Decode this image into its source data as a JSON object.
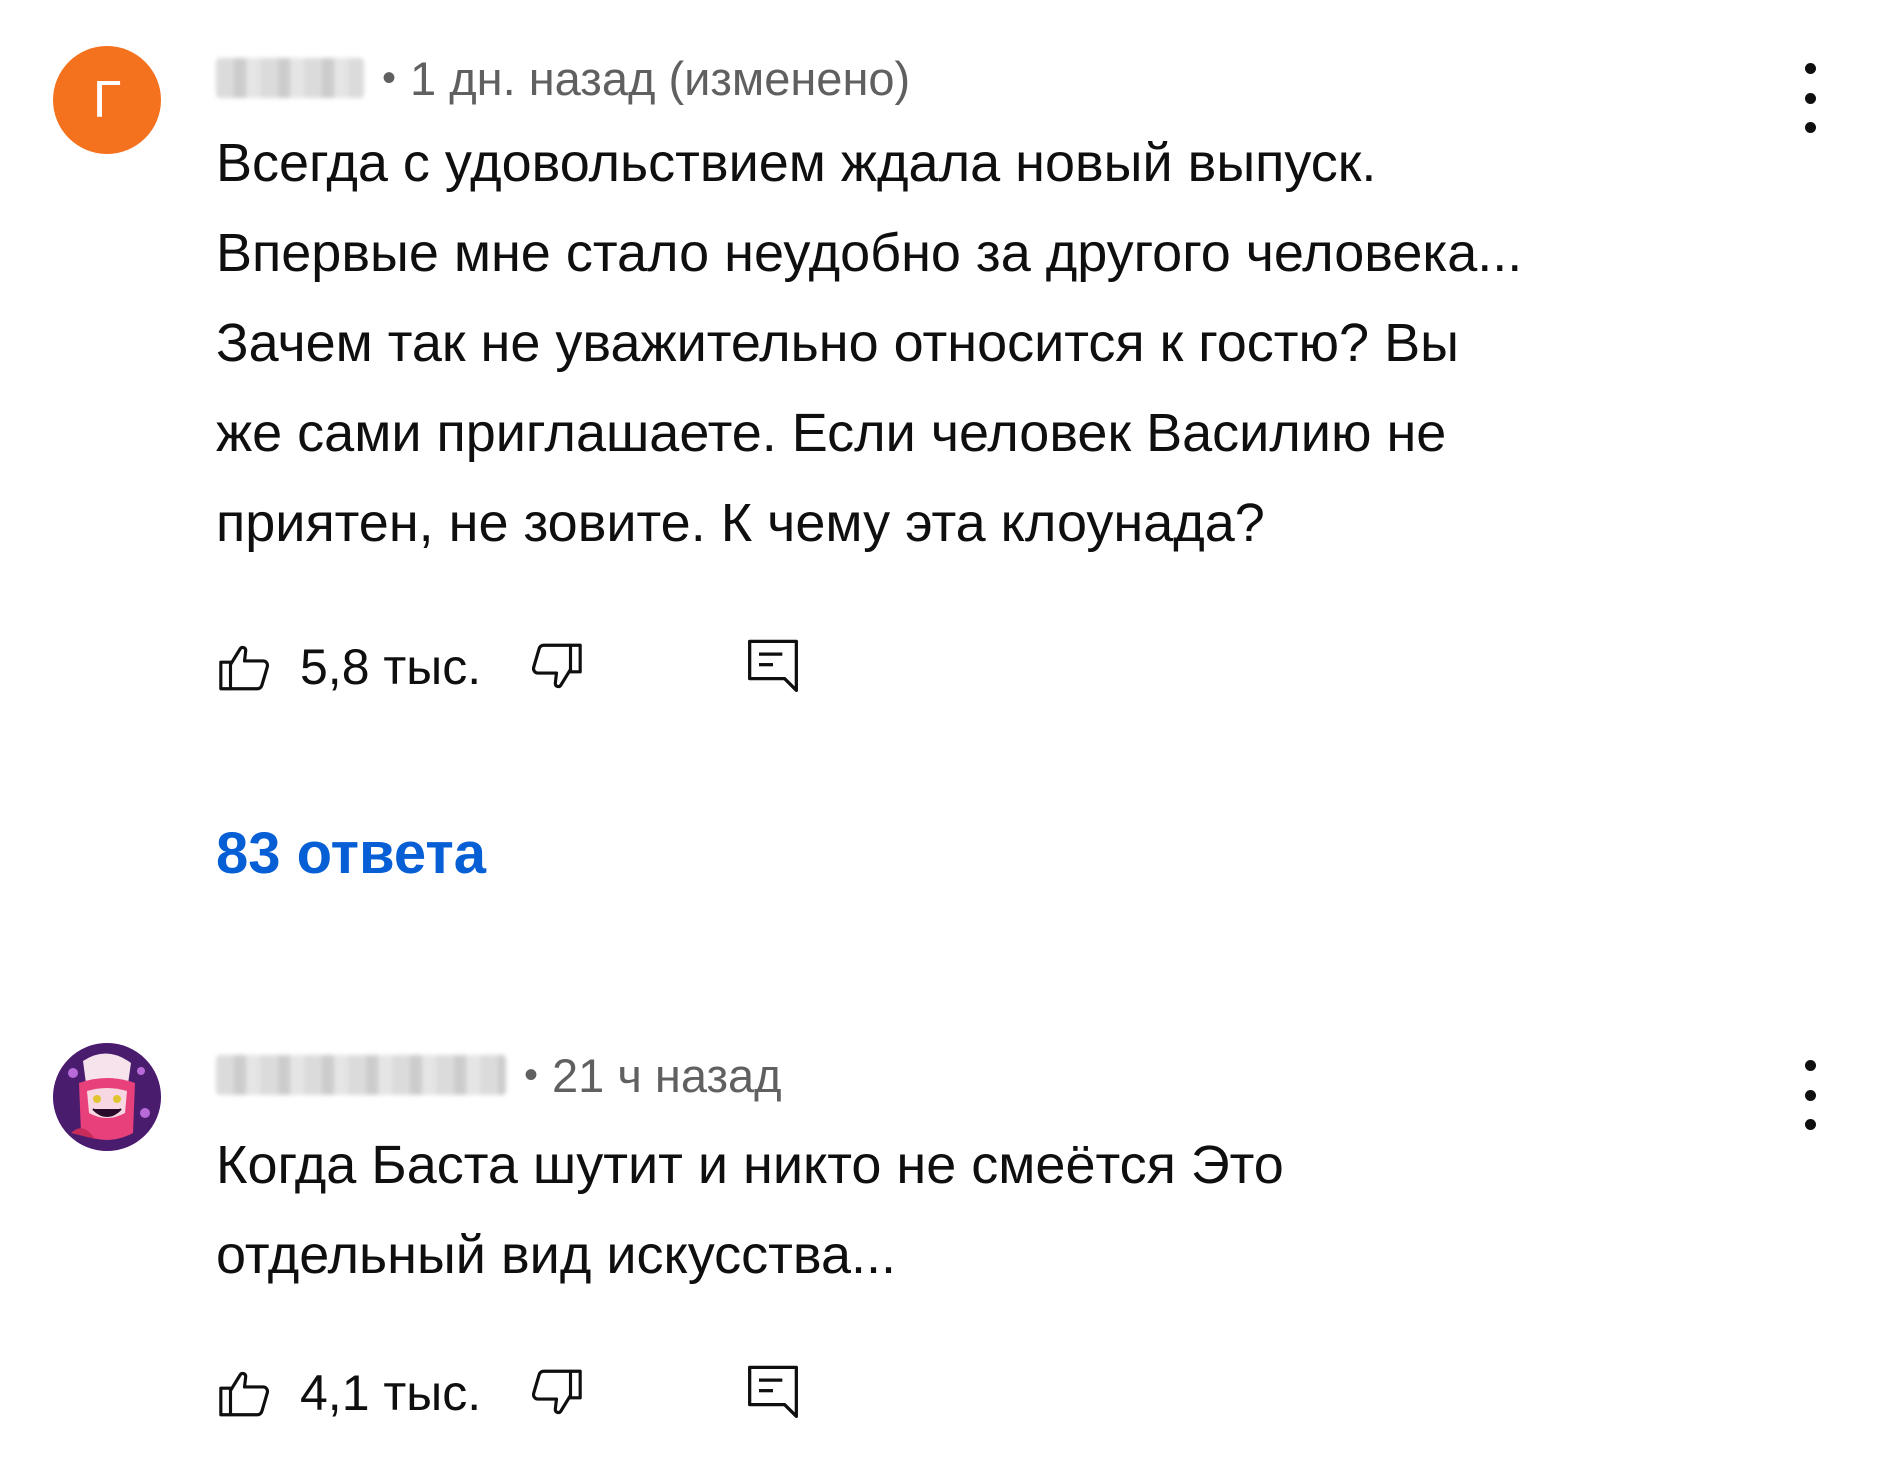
{
  "comments": [
    {
      "avatar_letter": "Г",
      "avatar_color": "#f4711e",
      "timestamp": "1 дн. назад (изменено)",
      "text_lines": [
        "Всегда с удовольствием ждала новый выпуск.",
        "Впервые мне стало неудобно за другого человека...",
        "Зачем так не уважительно относится к гостю? Вы",
        "же сами приглашаете. Если человек Василию не",
        "приятен, не зовите. К чему эта клоунада?"
      ],
      "likes": "5,8 тыс.",
      "replies": "83 ответа"
    },
    {
      "avatar_icon": "cartoon-character-avatar",
      "timestamp": "21 ч назад",
      "text_lines": [
        "Когда Баста шутит и никто не смеётся Это",
        "отдельный вид искусства..."
      ],
      "likes": "4,1 тыс."
    }
  ],
  "icons": {
    "like": "thumbs-up-icon",
    "dislike": "thumbs-down-icon",
    "reply": "reply-comment-icon",
    "menu": "more-vert-icon"
  },
  "colors": {
    "link": "#065fd4",
    "meta_text": "#606060",
    "primary_text": "#0f0f0f"
  }
}
